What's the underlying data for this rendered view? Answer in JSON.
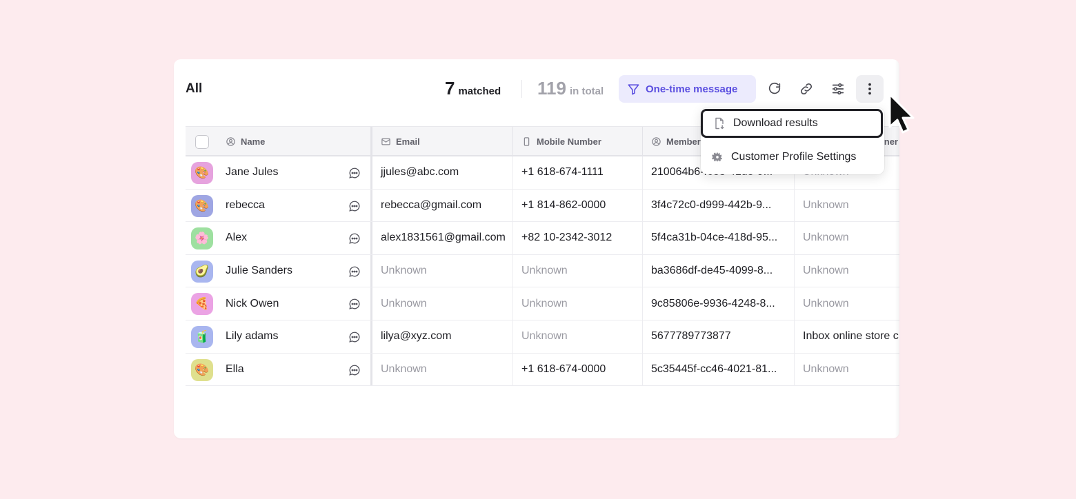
{
  "header": {
    "title": "All",
    "matched_count": "7",
    "matched_label": "matched",
    "total_count": "119",
    "total_label": "in total",
    "one_time_label": "One-time message"
  },
  "columns": {
    "name": "Name",
    "email": "Email",
    "mobile": "Mobile Number",
    "member": "Member",
    "partial": "ner"
  },
  "rows": [
    {
      "name": "Jane Jules",
      "avatar": "🎨",
      "avatar_bg": "#e6a3de",
      "email": "jjules@abc.com",
      "mobile": "+1 618-674-1111",
      "member": "210064b6-f683-41d8-9...",
      "last": "Unknown"
    },
    {
      "name": "rebecca",
      "avatar": "🎨",
      "avatar_bg": "#9fa6e3",
      "email": "rebecca@gmail.com",
      "mobile": "+1 814-862-0000",
      "member": "3f4c72c0-d999-442b-9...",
      "last": "Unknown"
    },
    {
      "name": "Alex",
      "avatar": "🌸",
      "avatar_bg": "#9ee0a0",
      "email": "alex1831561@gmail.com",
      "mobile": "+82 10-2342-3012",
      "member": "5f4ca31b-04ce-418d-95...",
      "last": "Unknown"
    },
    {
      "name": "Julie Sanders",
      "avatar": "🥑",
      "avatar_bg": "#a9b6ef",
      "email": "Unknown",
      "mobile": "Unknown",
      "member": "ba3686df-de45-4099-8...",
      "last": "Unknown"
    },
    {
      "name": "Nick Owen",
      "avatar": "🍕",
      "avatar_bg": "#eba3e4",
      "email": "Unknown",
      "mobile": "Unknown",
      "member": "9c85806e-9936-4248-8...",
      "last": "Unknown"
    },
    {
      "name": "Lily adams",
      "avatar": "🧃",
      "avatar_bg": "#a9b6ef",
      "email": "lilya@xyz.com",
      "mobile": "Unknown",
      "member": "5677789773877",
      "last": "Inbox online store c"
    },
    {
      "name": "Ella",
      "avatar": "🎨",
      "avatar_bg": "#dfe08e",
      "email": "Unknown",
      "mobile": "+1 618-674-0000",
      "member": "5c35445f-cc46-4021-81...",
      "last": "Unknown"
    }
  ],
  "menu": {
    "download": "Download results",
    "settings": "Customer Profile Settings"
  },
  "colors": {
    "background": "#fdebee",
    "accent": "#5b4fe0",
    "accent_bg": "#ecebfd",
    "muted_text": "#9a9aa2"
  },
  "icons": [
    "filter-icon",
    "refresh-icon",
    "link-icon",
    "sliders-icon",
    "more-vertical-icon",
    "file-download-icon",
    "gear-icon",
    "chat-icon",
    "user-circle-icon",
    "mail-icon",
    "phone-icon",
    "cursor-icon"
  ]
}
